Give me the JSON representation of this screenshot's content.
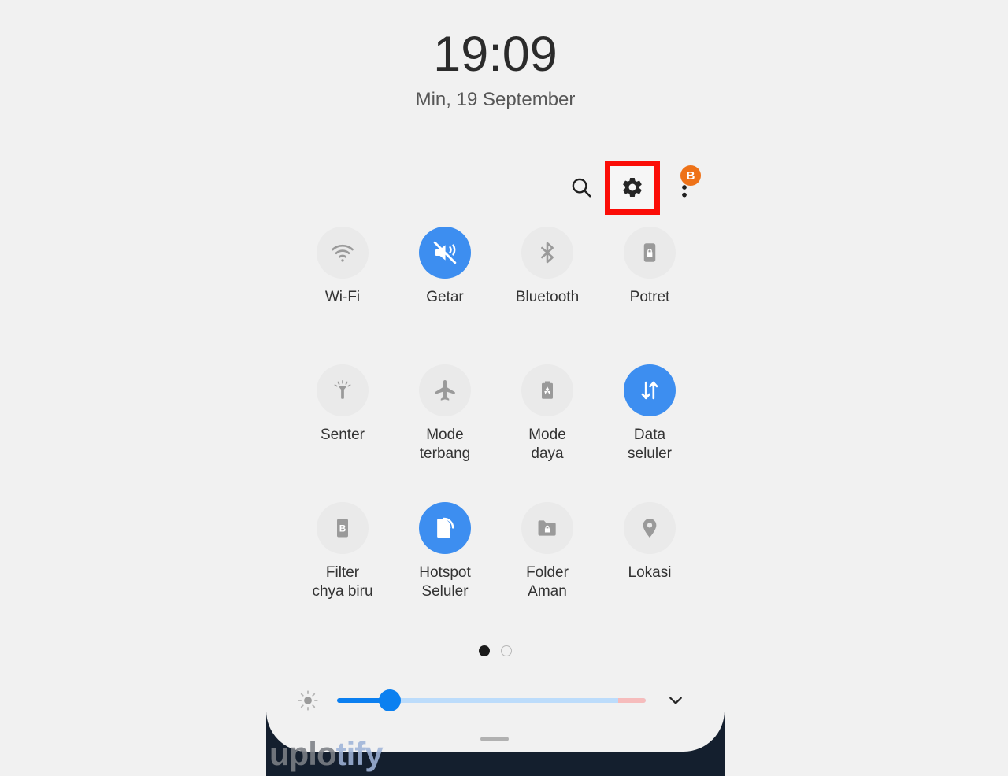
{
  "status": {
    "time": "19:09",
    "date": "Min, 19 September"
  },
  "header": {
    "search_label": "search-icon",
    "settings_label": "gear-icon",
    "more_label": "more-options-icon",
    "badge_text": "B",
    "badge_color": "#ee7218",
    "highlight_color": "#fb0d07"
  },
  "quick_settings": {
    "accent_on_color": "#3d8ef0",
    "tile_off_color": "#eaeaea",
    "rows": [
      [
        {
          "label": "Wi-Fi",
          "icon": "wifi-icon",
          "state": "off"
        },
        {
          "label": "Getar",
          "icon": "vibrate-icon",
          "state": "on"
        },
        {
          "label": "Bluetooth",
          "icon": "bluetooth-icon",
          "state": "off"
        },
        {
          "label": "Potret",
          "icon": "rotation-lock-icon",
          "state": "off"
        }
      ],
      [
        {
          "label": "Senter",
          "icon": "flashlight-icon",
          "state": "off"
        },
        {
          "label": "Mode\nterbang",
          "icon": "airplane-icon",
          "state": "off"
        },
        {
          "label": "Mode\ndaya",
          "icon": "power-saving-icon",
          "state": "off"
        },
        {
          "label": "Data\nseluler",
          "icon": "mobile-data-icon",
          "state": "on"
        }
      ],
      [
        {
          "label": "Filter\nchya biru",
          "icon": "blue-light-filter-icon",
          "state": "off"
        },
        {
          "label": "Hotspot\nSeluler",
          "icon": "hotspot-icon",
          "state": "on"
        },
        {
          "label": "Folder\nAman",
          "icon": "secure-folder-icon",
          "state": "off"
        },
        {
          "label": "Lokasi",
          "icon": "location-icon",
          "state": "off"
        }
      ]
    ]
  },
  "pager": {
    "total_pages": 2,
    "current_page": 1
  },
  "brightness": {
    "icon": "brightness-icon",
    "value_percent": 17,
    "warning_zone_percent": 9,
    "expand_icon": "chevron-down-icon"
  },
  "watermark": {
    "part_one": "uplo",
    "part_two": "tify"
  }
}
